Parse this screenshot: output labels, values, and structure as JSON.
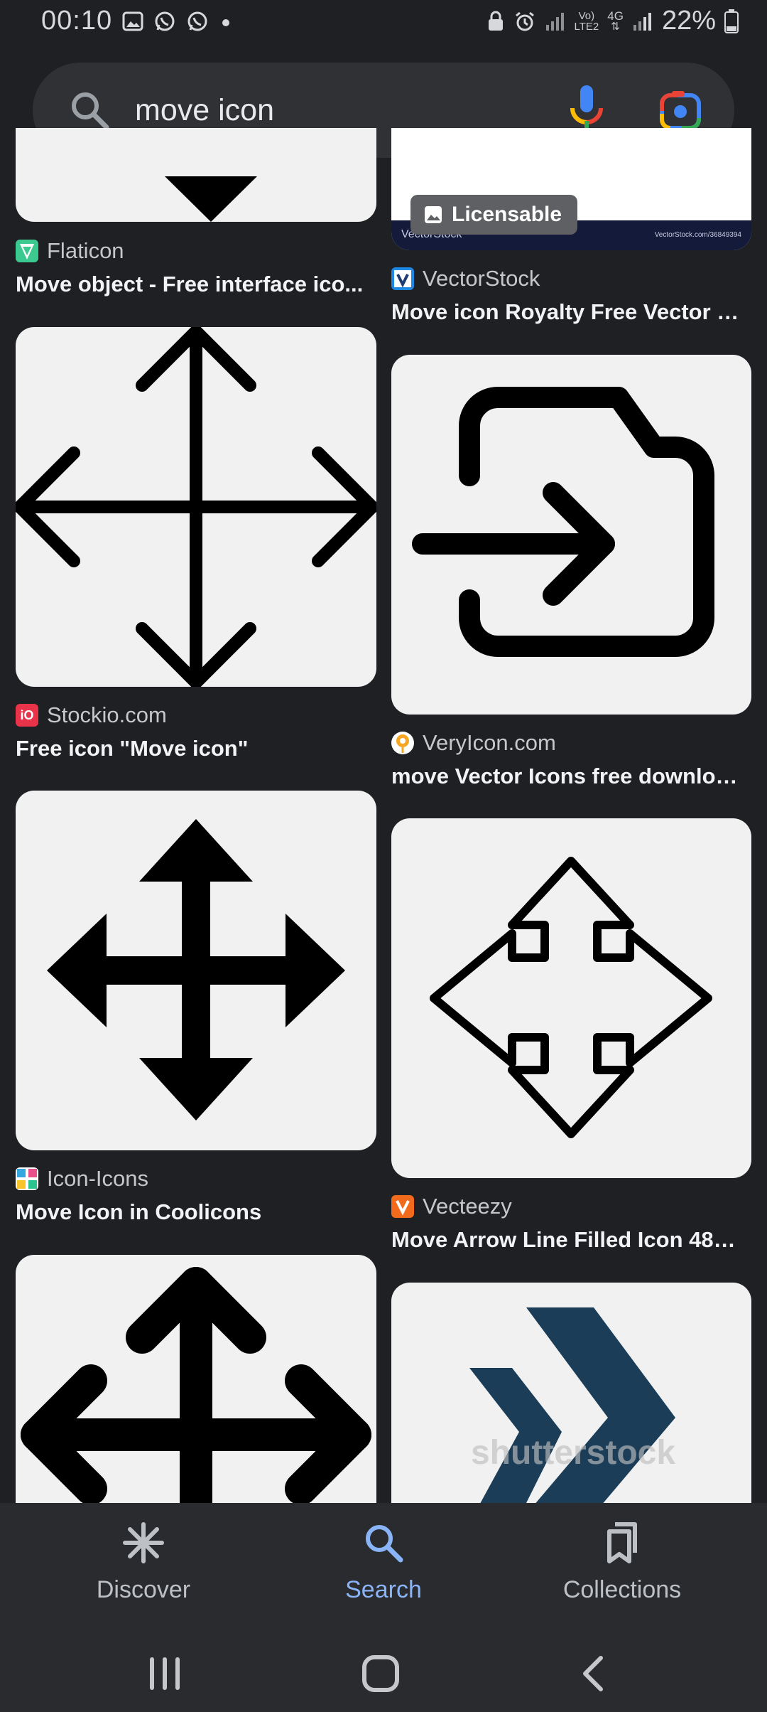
{
  "status": {
    "time": "00:10",
    "network_label_1": "Vo)",
    "network_label_2": "LTE2",
    "network_gen": "4G",
    "battery": "22%"
  },
  "search": {
    "query": "move icon",
    "icons": [
      "search-icon",
      "mic-icon",
      "google-lens-icon"
    ]
  },
  "results": [
    {
      "source": "Flaticon",
      "title": "Move object - Free interface ico...",
      "image": "down-triangle-icon",
      "favicon_color": "#3cc98f"
    },
    {
      "source": "VectorStock",
      "title": "Move icon Royalty Free Vector I...",
      "image": "vectorstock-thumbnail",
      "badge": "Licensable",
      "watermark": "VectorStock",
      "watermark_id": "VectorStock.com/36849394",
      "favicon_color": "#1e88e5"
    },
    {
      "source": "Stockio.com",
      "title": "Free icon \"Move icon\"",
      "image": "four-way-arrow-line-icon",
      "favicon_label": "iO",
      "favicon_color": "#e8334a"
    },
    {
      "source": "VeryIcon.com",
      "title": "move Vector Icons free downloa...",
      "image": "move-to-folder-icon",
      "favicon_color": "#f5a623"
    },
    {
      "source": "Icon-Icons",
      "title": "Move Icon in Coolicons",
      "image": "four-way-arrow-filled-icon",
      "favicon_color": "#34a7e0"
    },
    {
      "source": "Vecteezy",
      "title": "Move Arrow Line Filled Icon 485...",
      "image": "four-way-arrow-outline-icon",
      "favicon_color": "#f26b1d"
    },
    {
      "source": "",
      "title": "",
      "image": "four-way-arrow-rounded-icon"
    },
    {
      "source": "",
      "title": "",
      "image": "double-chevron-icon",
      "watermark": "shutterstock"
    }
  ],
  "nav": {
    "discover": "Discover",
    "search": "Search",
    "collections": "Collections",
    "active": "search"
  },
  "colors": {
    "background": "#1f2023",
    "search_bar": "#303134",
    "accent": "#8ab4f8"
  }
}
